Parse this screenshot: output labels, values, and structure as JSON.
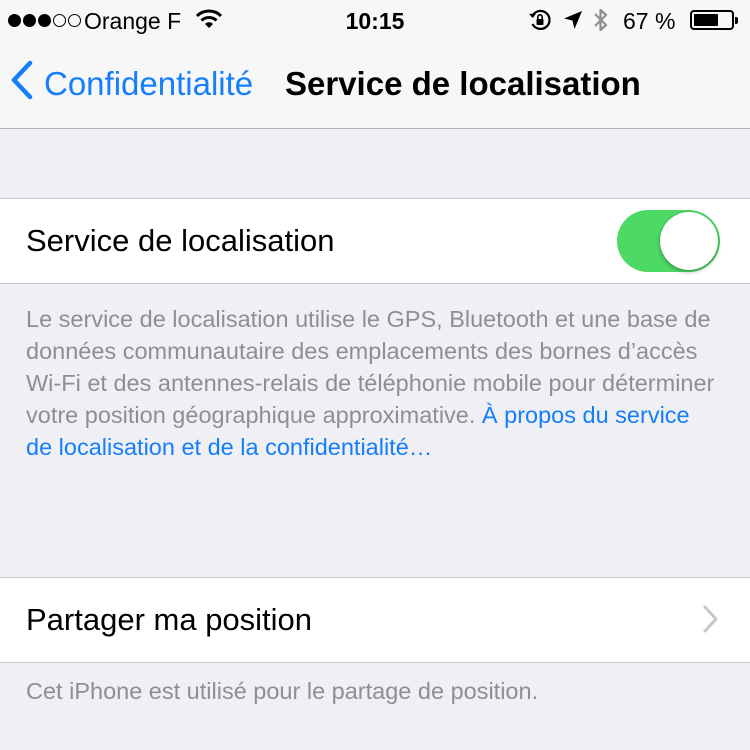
{
  "status_bar": {
    "signal_bars": 5,
    "signal_filled": 3,
    "carrier": "Orange F",
    "wifi_icon": "wifi-icon",
    "time": "10:15",
    "rotation_lock_icon": "rotation-lock-icon",
    "location_icon": "location-arrow-icon",
    "bluetooth_icon": "bluetooth-icon",
    "battery_percent_text": "67 %",
    "battery_level": 0.67
  },
  "nav": {
    "back_label": "Confidentialité",
    "title": "Service de localisation"
  },
  "location_services": {
    "label": "Service de localisation",
    "enabled": true,
    "on_color": "#4cd964"
  },
  "description": {
    "text": "Le service de localisation utilise le GPS, Bluetooth et une base de données communautaire des emplacements des bornes d’accès Wi-Fi et des antennes-relais de téléphonie mobile pour déterminer votre position géographique approximative. ",
    "link": "À propos du service de localisation et de la confidentialité…"
  },
  "share_location": {
    "label": "Partager ma position",
    "footer": "Cet iPhone est utilisé pour le partage de position."
  },
  "colors": {
    "accent": "#147efb",
    "background": "#efeff4",
    "footer_text": "#8e8e93"
  }
}
